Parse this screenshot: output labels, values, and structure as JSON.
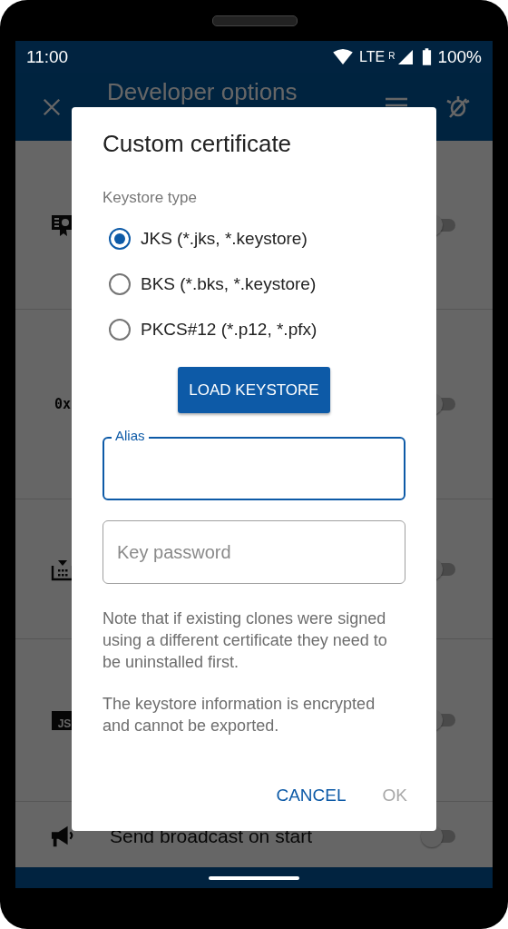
{
  "status_bar": {
    "time": "11:00",
    "network": "LTE",
    "roaming": "R",
    "battery": "100%"
  },
  "app_bar": {
    "title": "Developer options"
  },
  "settings": [
    {
      "on": false
    },
    {
      "badge": "0x",
      "on": false
    },
    {
      "on": false
    },
    {
      "badge": "JS",
      "on": false
    },
    {
      "label": "Send broadcast on start",
      "on": false
    }
  ],
  "dialog": {
    "title": "Custom certificate",
    "section_label": "Keystore type",
    "keystore_types": [
      {
        "label": "JKS (*.jks, *.keystore)",
        "selected": true
      },
      {
        "label": "BKS (*.bks, *.keystore)",
        "selected": false
      },
      {
        "label": "PKCS#12 (*.p12, *.pfx)",
        "selected": false
      }
    ],
    "load_button": "LOAD KEYSTORE",
    "fields": [
      {
        "label": "Alias",
        "focused": true
      },
      {
        "placeholder": "Key password",
        "focused": false
      }
    ],
    "notes": [
      "Note that if existing clones were signed using a different certificate they need to be uninstalled first.",
      "The keystore information is encrypted and cannot be exported."
    ],
    "buttons": [
      {
        "label": "CANCEL",
        "disabled": false
      },
      {
        "label": "OK",
        "disabled": true
      }
    ]
  }
}
